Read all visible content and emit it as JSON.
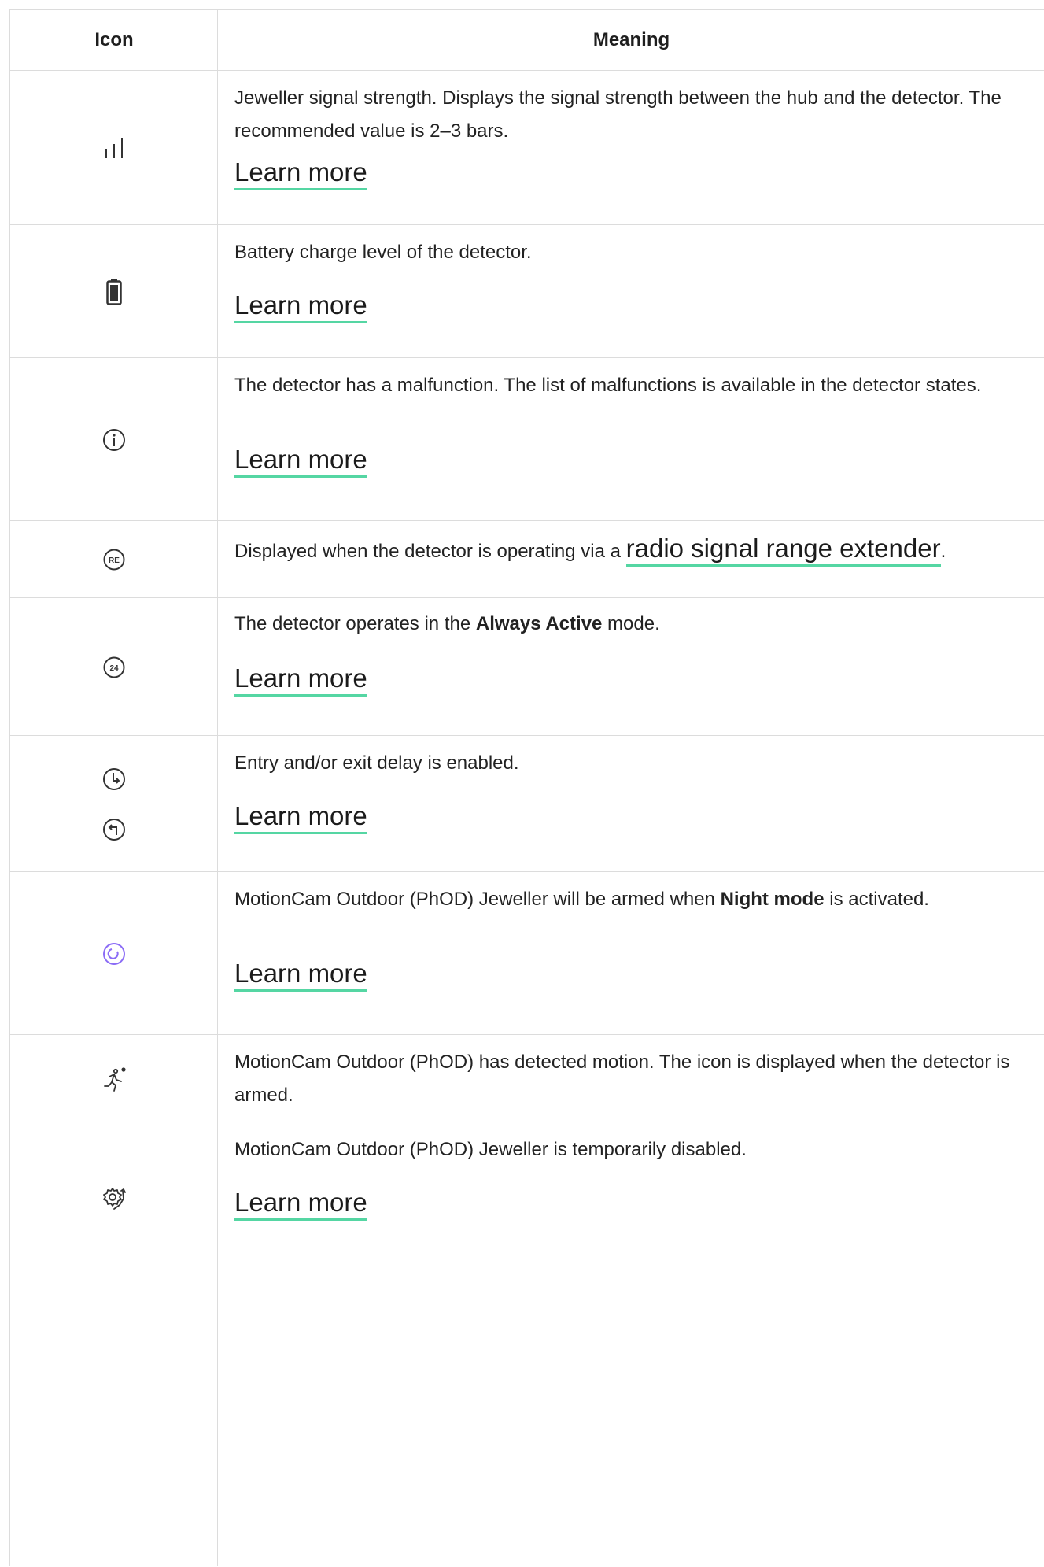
{
  "header": {
    "icon": "Icon",
    "meaning": "Meaning"
  },
  "rows": [
    {
      "icon": "signal-strength-icon",
      "text": "Jeweller signal strength. Displays the signal strength between the hub and the detector. The recommended value is 2–3 bars.",
      "link": "Learn more"
    },
    {
      "icon": "battery-icon",
      "text": "Battery charge level of the detector.",
      "link": "Learn more"
    },
    {
      "icon": "info-icon",
      "text": "The detector has a malfunction. The list of malfunctions is available in the detector states.",
      "link": "Learn more"
    },
    {
      "icon": "range-extender-icon",
      "text_before": "Displayed when the detector is operating via a ",
      "link": "radio signal range extender",
      "text_after": "."
    },
    {
      "icon": "always-active-24-icon",
      "text_before": "The detector operates in the ",
      "bold": "Always Active",
      "text_after": " mode.",
      "link": "Learn more"
    },
    {
      "icons": [
        "entry-delay-icon",
        "exit-delay-icon"
      ],
      "text": "Entry and/or exit delay is enabled.",
      "link": "Learn more"
    },
    {
      "icon": "night-mode-icon",
      "icon_color": "#8b6cf6",
      "text_before": "MotionCam Outdoor (PhOD) Jeweller will be armed when ",
      "bold": "Night mode",
      "text_after": " is activated.",
      "link": "Learn more"
    },
    {
      "icon": "motion-detected-icon",
      "text": "MotionCam Outdoor (PhOD) has detected motion. The icon is displayed when the detector is armed."
    },
    {
      "icon": "temporarily-disabled-icon",
      "text": "MotionCam Outdoor (PhOD) Jeweller is temporarily disabled.",
      "link": "Learn more"
    }
  ],
  "colors": {
    "link_underline": "#55d6a3",
    "border": "#dcdcdc",
    "night_mode": "#8b6cf6"
  }
}
